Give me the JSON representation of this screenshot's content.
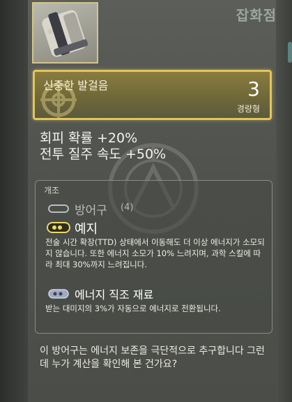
{
  "store": {
    "title": "잡화점"
  },
  "item": {
    "name": "신중한 발걸음",
    "count": "3",
    "type": "경량형",
    "thumbnail_icon": "chest-armor-icon",
    "header_color": "#e3c55a"
  },
  "stats": [
    "회피 확률 +20%",
    "전투 질주 속도 +50%"
  ],
  "mods": {
    "title": "개조",
    "slots": [
      {
        "icon": "empty-slot-icon",
        "name": "방어구",
        "count": "(4)"
      },
      {
        "icon": "perk-slot-icon",
        "name": "예지",
        "description": "전술 시간 확장(TTD) 상태에서 이동해도 더 이상 에너지가 소모되지 않습니다. 또한 에너지 소모가 10% 느려지며, 과학 스킬에 따라 최대 30%까지 느려집니다."
      },
      {
        "icon": "material-slot-icon",
        "name": "에너지 직조 재료",
        "description": "받는 대미지의 3%가 자동으로 에너지로 전환됩니다."
      }
    ]
  },
  "flavor_text": "이 방어구는 에너지 보존을 극단적으로 추구합니다 그런데 누가 계산을 확인해 본 건가요?"
}
